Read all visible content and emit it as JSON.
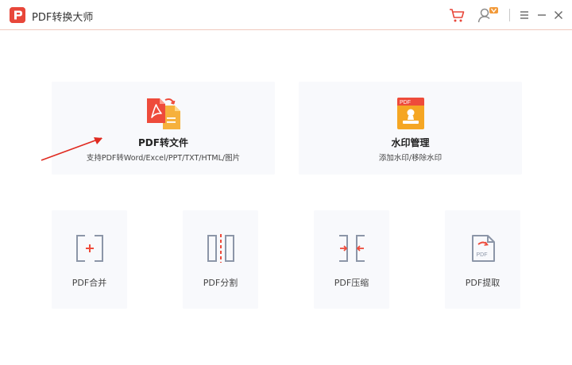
{
  "titlebar": {
    "app_title": "PDF转换大师",
    "icons": [
      "app-logo-icon",
      "cart-icon",
      "user-vip-icon",
      "menu-icon",
      "minimize-icon",
      "close-icon"
    ]
  },
  "features": {
    "pdf_convert": {
      "title": "PDF转文件",
      "desc": "支持PDF转Word/Excel/PPT/TXT/HTML/图片",
      "icon": "pdf-convert-icon"
    },
    "watermark": {
      "title": "水印管理",
      "desc": "添加水印/移除水印",
      "icon": "watermark-icon",
      "icon_badge": "PDF"
    }
  },
  "tools": [
    {
      "label": "PDF合并",
      "icon": "merge-icon"
    },
    {
      "label": "PDF分割",
      "icon": "split-icon"
    },
    {
      "label": "PDF压缩",
      "icon": "compress-icon"
    },
    {
      "label": "PDF提取",
      "icon": "extract-icon"
    }
  ],
  "colors": {
    "accent": "#e8473a",
    "icon_gray": "#8c96a8",
    "card_bg": "#f8f9fc",
    "orange": "#f5a623"
  }
}
